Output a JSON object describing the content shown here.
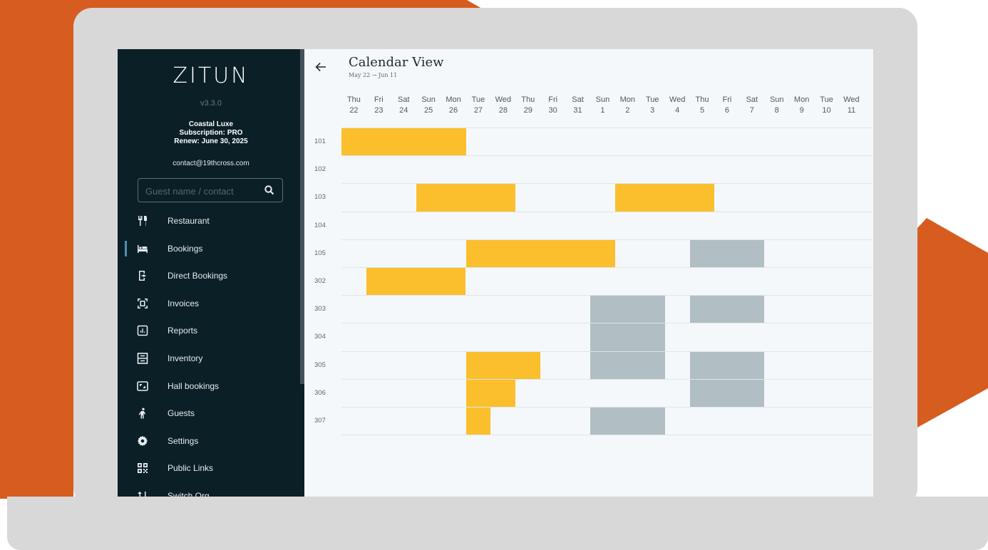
{
  "app": {
    "logo": "ZITUN",
    "version": "v3.3.0",
    "org_name": "Coastal Luxe",
    "subscription": "Subscription: PRO",
    "renew": "Renew: June 30, 2025",
    "email": "contact@19thcross.com"
  },
  "search": {
    "placeholder": "Guest name / contact",
    "value": ""
  },
  "sidebar": {
    "items": [
      {
        "label": "Restaurant",
        "icon": "restaurant-icon"
      },
      {
        "label": "Bookings",
        "icon": "bed-icon",
        "active": true
      },
      {
        "label": "Direct Bookings",
        "icon": "direct-booking-icon"
      },
      {
        "label": "Invoices",
        "icon": "invoice-icon"
      },
      {
        "label": "Reports",
        "icon": "report-icon"
      },
      {
        "label": "Inventory",
        "icon": "inventory-icon"
      },
      {
        "label": "Hall bookings",
        "icon": "hall-icon"
      },
      {
        "label": "Guests",
        "icon": "guest-icon"
      },
      {
        "label": "Settings",
        "icon": "gear-icon"
      },
      {
        "label": "Public Links",
        "icon": "qr-icon"
      },
      {
        "label": "Switch Org",
        "icon": "switch-icon"
      }
    ]
  },
  "header": {
    "title": "Calendar View",
    "range": "May 22  →  Jun 11"
  },
  "calendar": {
    "days": [
      {
        "dow": "Thu",
        "date": "22"
      },
      {
        "dow": "Fri",
        "date": "23"
      },
      {
        "dow": "Sat",
        "date": "24"
      },
      {
        "dow": "Sun",
        "date": "25"
      },
      {
        "dow": "Mon",
        "date": "26"
      },
      {
        "dow": "Tue",
        "date": "27"
      },
      {
        "dow": "Wed",
        "date": "28"
      },
      {
        "dow": "Thu",
        "date": "29"
      },
      {
        "dow": "Fri",
        "date": "30"
      },
      {
        "dow": "Sat",
        "date": "31"
      },
      {
        "dow": "Sun",
        "date": "1"
      },
      {
        "dow": "Mon",
        "date": "2"
      },
      {
        "dow": "Tue",
        "date": "3"
      },
      {
        "dow": "Wed",
        "date": "4"
      },
      {
        "dow": "Thu",
        "date": "5"
      },
      {
        "dow": "Fri",
        "date": "6"
      },
      {
        "dow": "Sat",
        "date": "7"
      },
      {
        "dow": "Sun",
        "date": "8"
      },
      {
        "dow": "Mon",
        "date": "9"
      },
      {
        "dow": "Tue",
        "date": "10"
      },
      {
        "dow": "Wed",
        "date": "11"
      }
    ],
    "rooms": [
      "101",
      "102",
      "103",
      "104",
      "105",
      "302",
      "303",
      "304",
      "305",
      "306",
      "307"
    ],
    "bookings": [
      {
        "room": 0,
        "start": 0,
        "span": 5,
        "kind": "booked"
      },
      {
        "room": 2,
        "start": 3,
        "span": 4,
        "kind": "booked"
      },
      {
        "room": 2,
        "start": 11,
        "span": 4,
        "kind": "booked"
      },
      {
        "room": 4,
        "start": 5,
        "span": 6,
        "kind": "booked"
      },
      {
        "room": 4,
        "start": 14,
        "span": 3,
        "kind": "blocked"
      },
      {
        "room": 5,
        "start": 1,
        "span": 4,
        "kind": "booked"
      },
      {
        "room": 6,
        "start": 10,
        "span": 3,
        "kind": "blocked"
      },
      {
        "room": 6,
        "start": 14,
        "span": 3,
        "kind": "blocked"
      },
      {
        "room": 7,
        "start": 10,
        "span": 3,
        "kind": "blocked"
      },
      {
        "room": 8,
        "start": 5,
        "span": 3,
        "kind": "booked"
      },
      {
        "room": 8,
        "start": 10,
        "span": 3,
        "kind": "blocked"
      },
      {
        "room": 8,
        "start": 14,
        "span": 3,
        "kind": "blocked"
      },
      {
        "room": 9,
        "start": 5,
        "span": 2,
        "kind": "booked"
      },
      {
        "room": 9,
        "start": 14,
        "span": 3,
        "kind": "blocked"
      },
      {
        "room": 10,
        "start": 5,
        "span": 1,
        "kind": "booked"
      },
      {
        "room": 10,
        "start": 10,
        "span": 3,
        "kind": "blocked"
      }
    ]
  },
  "colors": {
    "booked": "#fbbf2d",
    "blocked": "#b1bec3",
    "orange": "#d65c20",
    "sidebar": "#0b1f26"
  }
}
